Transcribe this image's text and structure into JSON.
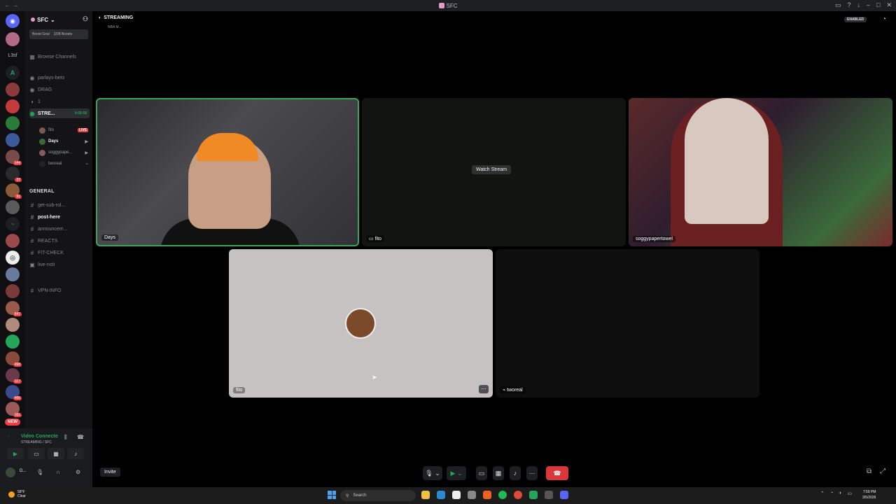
{
  "window": {
    "title": "SFC"
  },
  "servers": {
    "items": [
      {
        "label": "",
        "badge": ""
      },
      {
        "label": "",
        "badge": ""
      },
      {
        "label": "A",
        "badge": ""
      },
      {
        "label": "",
        "badge": ""
      },
      {
        "label": "",
        "badge": ""
      },
      {
        "label": "",
        "badge": ""
      },
      {
        "label": "",
        "badge": ""
      },
      {
        "label": "",
        "badge": "144"
      },
      {
        "label": "",
        "badge": "37"
      },
      {
        "label": "",
        "badge": "91"
      },
      {
        "label": "",
        "badge": ""
      },
      {
        "label": "",
        "badge": ""
      },
      {
        "label": "",
        "badge": ""
      },
      {
        "label": "",
        "badge": ""
      },
      {
        "label": "",
        "badge": "847"
      },
      {
        "label": "",
        "badge": ""
      },
      {
        "label": "",
        "badge": "498"
      },
      {
        "label": "",
        "badge": "117"
      },
      {
        "label": "",
        "badge": "466"
      },
      {
        "label": "",
        "badge": "161"
      }
    ],
    "folder_label": "L3sf",
    "new_label": "NEW"
  },
  "sidebar": {
    "server_name": "SFC",
    "boost_goal": "Boost Goal",
    "boost_count": "2/28 Boosts",
    "browse": "Browse Channels",
    "channels": [
      {
        "name": "parlays-bets",
        "icon": "◉"
      },
      {
        "name": "DRAG",
        "icon": "◉"
      },
      {
        "name": "1",
        "icon": "◖"
      },
      {
        "name": "STRE...",
        "icon": "◉",
        "timer": "4:00:58"
      }
    ],
    "voice_users": [
      {
        "name": "fito",
        "status": "LIVE"
      },
      {
        "name": "Days",
        "status": "cam"
      },
      {
        "name": "soggypape...",
        "status": "cam"
      },
      {
        "name": "tworeal",
        "status": ""
      }
    ],
    "category_general": "GENERAL",
    "text_channels": [
      {
        "name": "get-sub-rol...",
        "bold": false
      },
      {
        "name": "post-here",
        "bold": true
      },
      {
        "name": "announcem...",
        "bold": false
      },
      {
        "name": "REACTS",
        "bold": false
      },
      {
        "name": "FIT-CHECK",
        "bold": false
      },
      {
        "name": "live-noti",
        "bold": false
      }
    ],
    "vpn": "VPN-INFO"
  },
  "voice_panel": {
    "status": "Video Connecte",
    "sub": "STREAMING / SFC",
    "user": "D..."
  },
  "stage": {
    "channel": "STREAMING",
    "sub": "NBA M...",
    "enabled": "ENABLED",
    "tiles": {
      "days": "Days",
      "fito_stream": "fito",
      "watch_stream": "Watch Stream",
      "soggy": "soggypapertowel",
      "fito": "fito",
      "tworeal": "tworeal"
    }
  },
  "controls": {
    "invite": "Invite"
  },
  "taskbar": {
    "weather_temp": "58°F",
    "weather_desc": "Clear",
    "search": "Search",
    "time": "7:59 PM",
    "date": "3/5/2026"
  },
  "colors": {
    "accent_green": "#3ba55d",
    "danger": "#da373c",
    "live": "#f23f43"
  }
}
